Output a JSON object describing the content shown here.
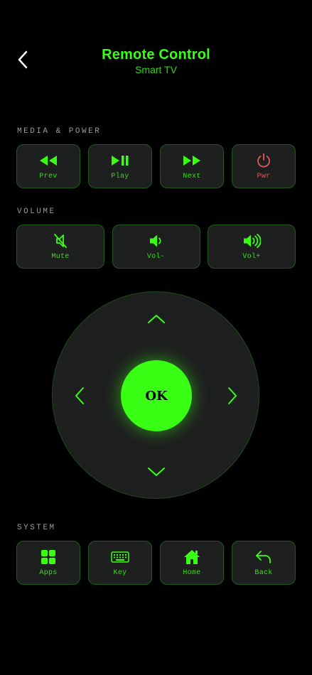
{
  "header": {
    "title": "Remote Control",
    "subtitle": "Smart TV"
  },
  "sections": {
    "media": "MEDIA & POWER",
    "volume": "VOLUME",
    "system": "SYSTEM"
  },
  "media_buttons": [
    {
      "label": "Prev",
      "icon": "rewind-icon"
    },
    {
      "label": "Play",
      "icon": "play-pause-icon"
    },
    {
      "label": "Next",
      "icon": "fast-forward-icon"
    },
    {
      "label": "Pwr",
      "icon": "power-icon"
    }
  ],
  "volume_buttons": [
    {
      "label": "Mute",
      "icon": "mute-icon"
    },
    {
      "label": "Vol-",
      "icon": "volume-down-icon"
    },
    {
      "label": "Vol+",
      "icon": "volume-up-icon"
    }
  ],
  "dpad": {
    "ok_label": "OK"
  },
  "system_buttons": [
    {
      "label": "Apps",
      "icon": "apps-grid-icon"
    },
    {
      "label": "Key",
      "icon": "keyboard-icon"
    },
    {
      "label": "Home",
      "icon": "home-icon"
    },
    {
      "label": "Back",
      "icon": "back-arrow-icon"
    }
  ],
  "colors": {
    "accent": "#39ff14",
    "power": "#e25a5a",
    "button_bg": "#1e1f1f",
    "background": "#000000"
  }
}
